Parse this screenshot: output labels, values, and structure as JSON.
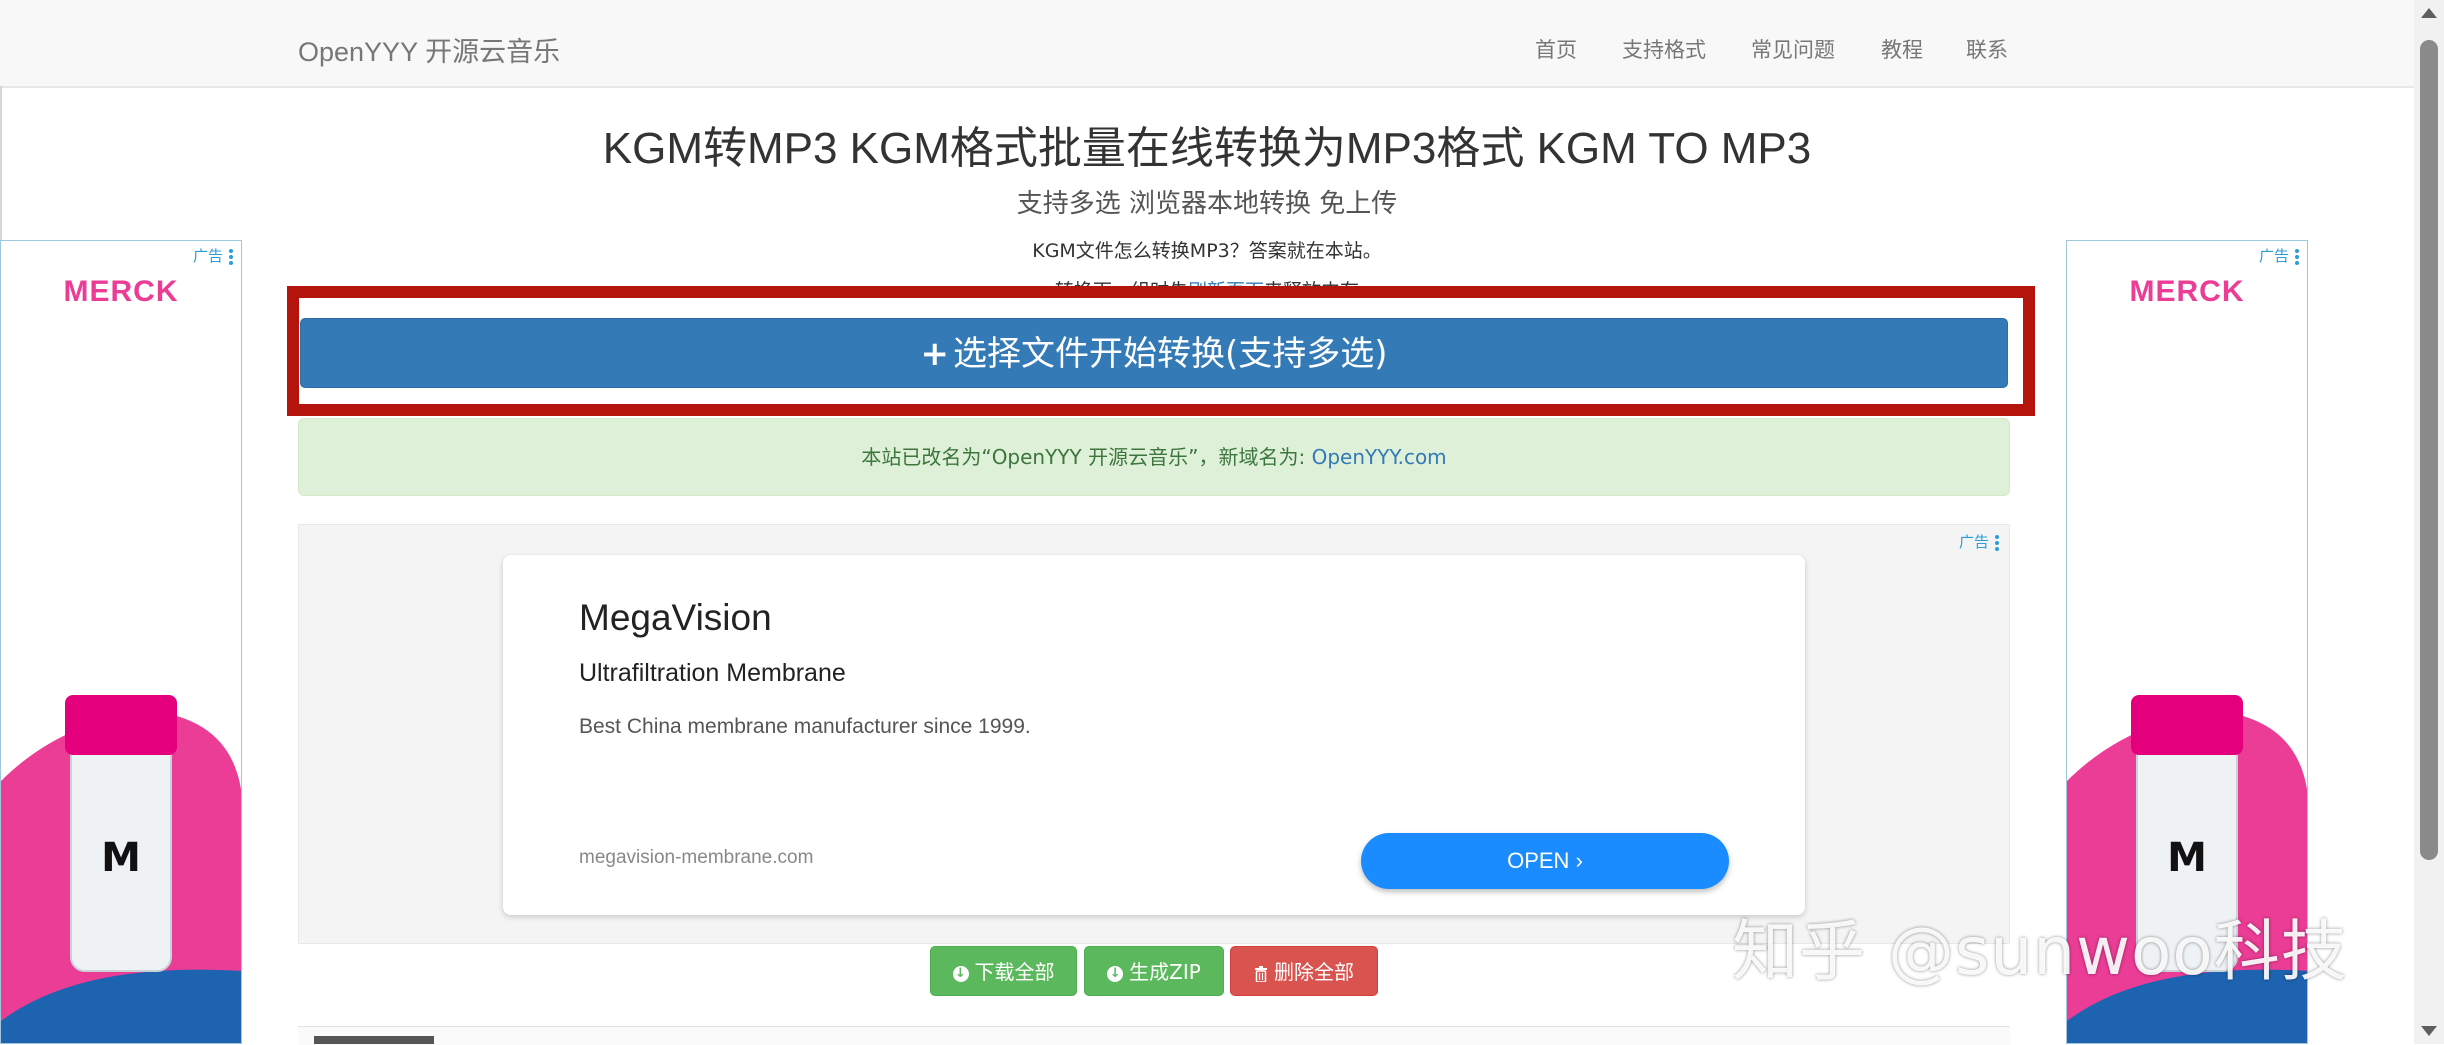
{
  "navbar": {
    "brand": "OpenYYY 开源云音乐",
    "items": [
      "首页",
      "支持格式",
      "常见问题",
      "教程",
      "联系"
    ]
  },
  "page": {
    "title": "KGM转MP3 KGM格式批量在线转换为MP3格式 KGM TO MP3",
    "subtitle": "支持多选 浏览器本地转换 免上传",
    "intro": "KGM文件怎么转换MP3？答案就在本站。",
    "hint_prefix": "转换下一组时先",
    "hint_link": "刷新页面",
    "hint_suffix": "来释放内存"
  },
  "upload": {
    "plus": "+",
    "label": "选择文件开始转换(支持多选)"
  },
  "notice": {
    "text": "本站已改名为“OpenYYY 开源云音乐”，新域名为: ",
    "link": "OpenYYY.com"
  },
  "ads": {
    "label": "广告",
    "side_brand": "MERCK",
    "center": {
      "title": "MegaVision",
      "subtitle": "Ultrafiltration Membrane",
      "description": "Best China membrane manufacturer since 1999.",
      "url": "megavision-membrane.com",
      "cta": "OPEN"
    }
  },
  "actions": {
    "download_all": "下载全部",
    "make_zip": "生成ZIP",
    "delete_all": "删除全部"
  },
  "watermark": "知乎 @sunwoo科技",
  "colors": {
    "primary": "#337ab7",
    "success": "#5cb85c",
    "danger": "#d9534f",
    "highlight": "#b5140d",
    "merck_pink": "#eb3c96"
  }
}
